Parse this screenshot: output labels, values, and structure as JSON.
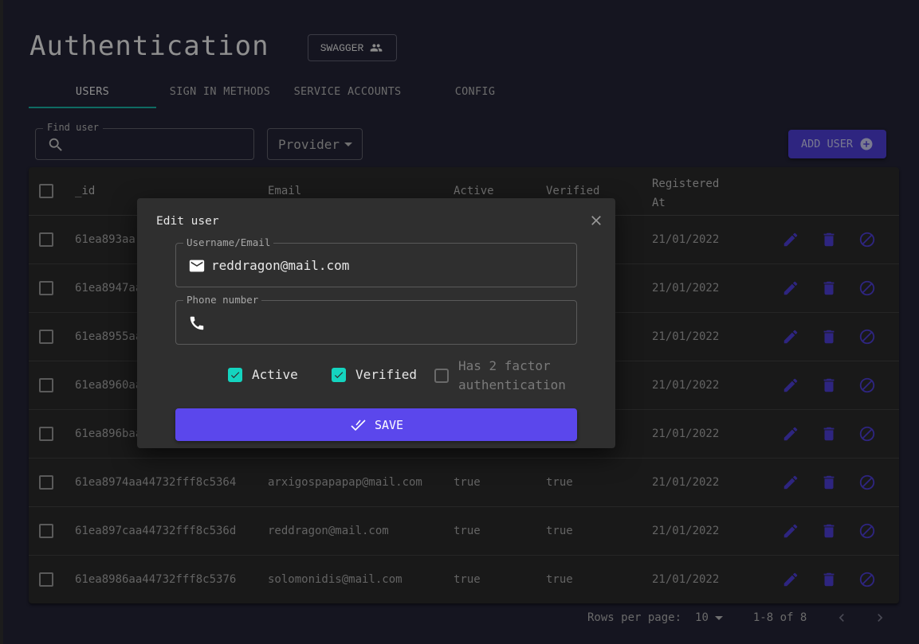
{
  "header": {
    "title": "Authentication",
    "swagger_label": "SWAGGER"
  },
  "tabs": [
    {
      "label": "USERS",
      "active": true
    },
    {
      "label": "SIGN IN METHODS",
      "active": false
    },
    {
      "label": "SERVICE ACCOUNTS",
      "active": false
    },
    {
      "label": "CONFIG",
      "active": false
    }
  ],
  "toolbar": {
    "find_user_label": "Find user",
    "find_user_value": "",
    "provider_label": "Provider",
    "add_user_label": "ADD USER"
  },
  "table": {
    "columns": [
      "_id",
      "Email",
      "Active",
      "Verified",
      "Registered At"
    ],
    "column_registered_line1": "Registered",
    "column_registered_line2": "At",
    "rows": [
      {
        "id": "61ea893aa",
        "email": "",
        "active": "",
        "verified": "",
        "registered": "21/01/2022"
      },
      {
        "id": "61ea8947aa",
        "email": "",
        "active": "",
        "verified": "",
        "registered": "21/01/2022"
      },
      {
        "id": "61ea8955aa",
        "email": "",
        "active": "",
        "verified": "",
        "registered": "21/01/2022"
      },
      {
        "id": "61ea8960aa",
        "email": "",
        "active": "",
        "verified": "",
        "registered": "21/01/2022"
      },
      {
        "id": "61ea896baa",
        "email": "",
        "active": "",
        "verified": "",
        "registered": "21/01/2022"
      },
      {
        "id": "61ea8974aa44732fff8c5364",
        "email": "arxigospapapap@mail.com",
        "active": "true",
        "verified": "true",
        "registered": "21/01/2022"
      },
      {
        "id": "61ea897caa44732fff8c536d",
        "email": "reddragon@mail.com",
        "active": "true",
        "verified": "true",
        "registered": "21/01/2022"
      },
      {
        "id": "61ea8986aa44732fff8c5376",
        "email": "solomonidis@mail.com",
        "active": "true",
        "verified": "true",
        "registered": "21/01/2022"
      }
    ],
    "action_icons": [
      "edit-icon",
      "delete-icon",
      "block-icon"
    ],
    "action_color": "#2e2580"
  },
  "pagination": {
    "rows_per_page_label": "Rows per page:",
    "rows_per_page_value": "10",
    "range": "1-8 of 8"
  },
  "dialog": {
    "title": "Edit user",
    "username_label": "Username/Email",
    "username_value": "reddragon@mail.com",
    "phone_label": "Phone number",
    "phone_value": "",
    "active_label": "Active",
    "active_checked": true,
    "verified_label": "Verified",
    "verified_checked": true,
    "twofa_label_line1": "Has 2 factor",
    "twofa_label_line2": "authentication",
    "twofa_checked": false,
    "save_label": "SAVE"
  },
  "colors": {
    "accent": "#5b47ec",
    "checkbox": "#14d4bf",
    "tab_indicator": "#0f6b62"
  }
}
